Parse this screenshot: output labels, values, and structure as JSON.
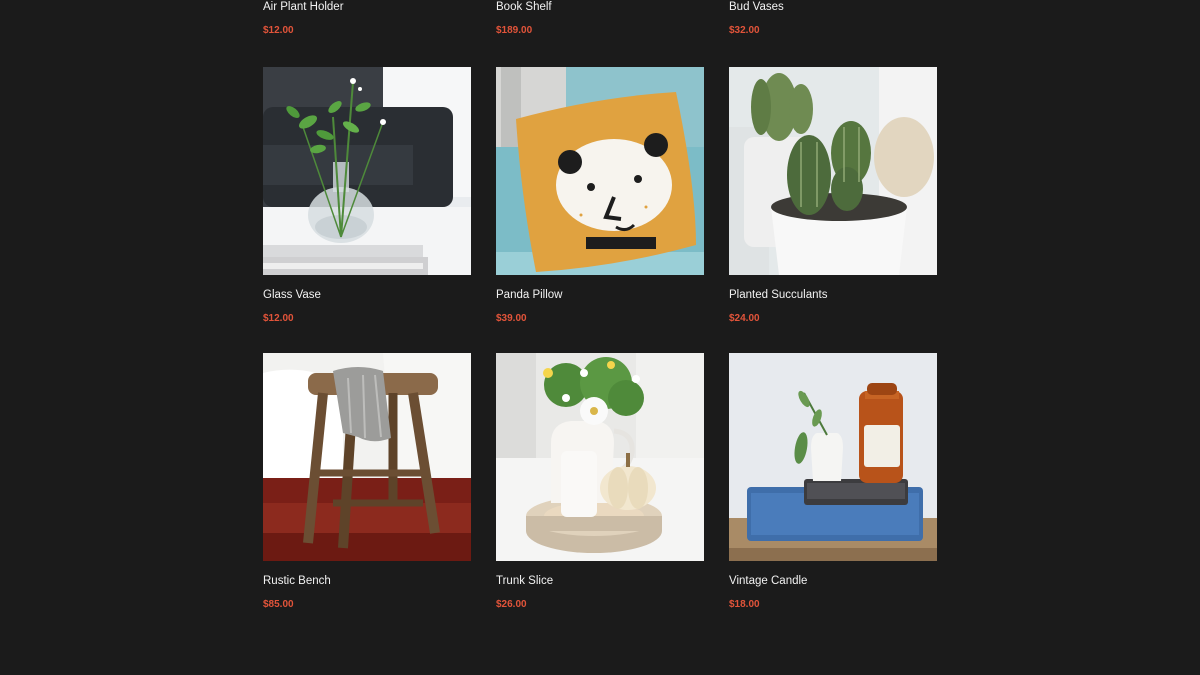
{
  "products_top": [
    {
      "name": "Air Plant Holder",
      "price": "$12.00"
    },
    {
      "name": "Book Shelf",
      "price": "$189.00"
    },
    {
      "name": "Bud Vases",
      "price": "$32.00"
    }
  ],
  "products": [
    {
      "name": "Glass Vase",
      "price": "$12.00",
      "image": "glass-vase-image"
    },
    {
      "name": "Panda Pillow",
      "price": "$39.00",
      "image": "panda-pillow-image"
    },
    {
      "name": "Planted Succulants",
      "price": "$24.00",
      "image": "planted-succulents-image"
    },
    {
      "name": "Rustic Bench",
      "price": "$85.00",
      "image": "rustic-bench-image"
    },
    {
      "name": "Trunk Slice",
      "price": "$26.00",
      "image": "trunk-slice-image"
    },
    {
      "name": "Vintage Candle",
      "price": "$18.00",
      "image": "vintage-candle-image"
    }
  ],
  "colors": {
    "background": "#1b1b1b",
    "price": "#e2543a",
    "title": "#f2f2f2"
  }
}
